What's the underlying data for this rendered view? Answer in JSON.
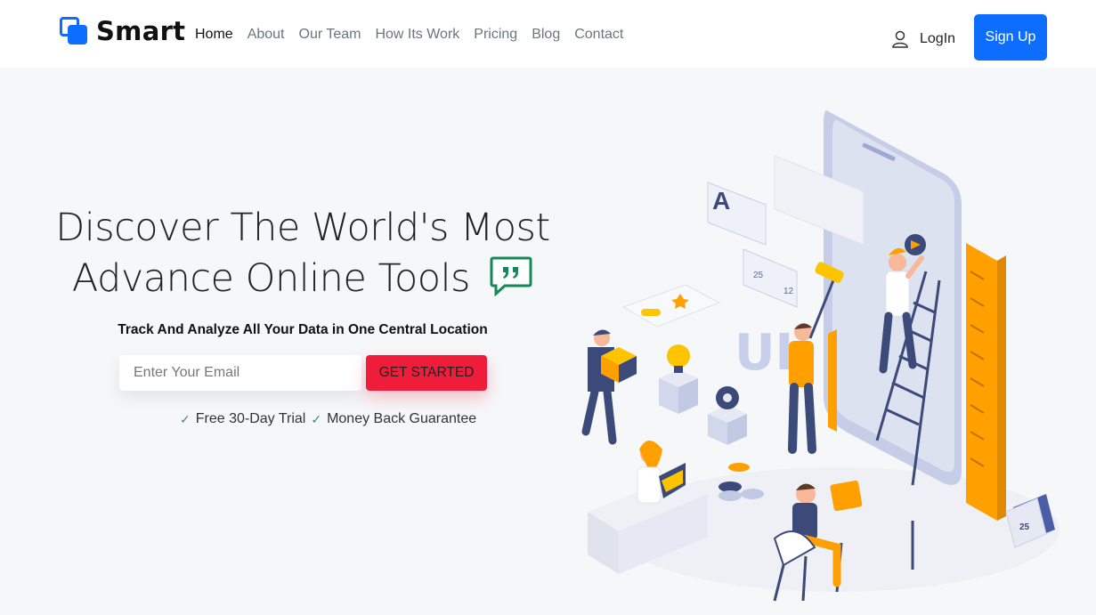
{
  "brand": {
    "name": "Smart",
    "primary_color": "#0d6efd"
  },
  "nav": {
    "items": [
      {
        "label": "Home",
        "active": true
      },
      {
        "label": "About"
      },
      {
        "label": "Our Team"
      },
      {
        "label": "How Its Work"
      },
      {
        "label": "Pricing"
      },
      {
        "label": "Blog"
      },
      {
        "label": "Contact"
      }
    ]
  },
  "auth": {
    "login_label": "LogIn",
    "signup_label": "Sign Up",
    "login_icon": "user-icon"
  },
  "hero": {
    "title_line1": "Discover The World's Most",
    "title_line2": "Advance Online Tools",
    "title_icon": "quote-bubble-icon",
    "subtitle": "Track And Analyze All Your Data in One Central Location",
    "email_placeholder": "Enter Your Email",
    "cta_label": "GET STARTED",
    "cta_color": "#ef1c3a",
    "perks": [
      "Free 30-Day Trial",
      "Money Back Guarantee"
    ],
    "illustration_badges": [
      "25",
      "12",
      "25",
      "A",
      "UI"
    ]
  }
}
